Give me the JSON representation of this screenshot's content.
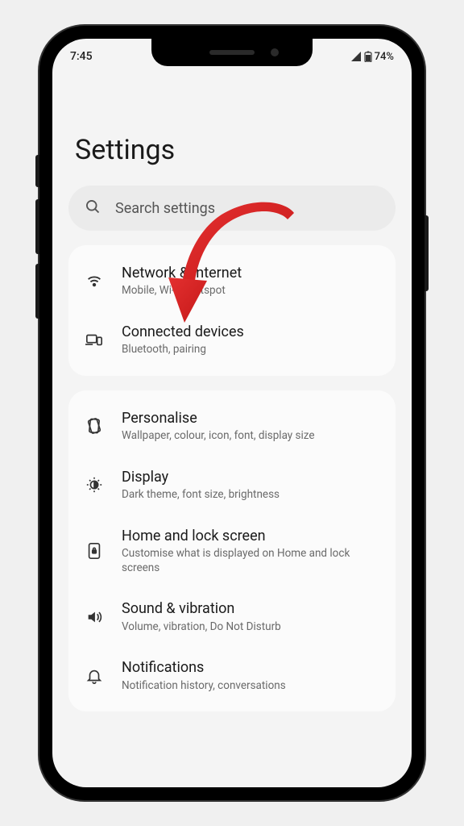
{
  "status": {
    "time": "7:45",
    "battery": "74%"
  },
  "page": {
    "title": "Settings"
  },
  "search": {
    "placeholder": "Search settings"
  },
  "groups": [
    {
      "items": [
        {
          "icon": "wifi",
          "title": "Network & Internet",
          "sub": "Mobile, Wi-Fi, hotspot"
        },
        {
          "icon": "devices",
          "title": "Connected devices",
          "sub": "Bluetooth, pairing"
        }
      ]
    },
    {
      "items": [
        {
          "icon": "palette",
          "title": "Personalise",
          "sub": "Wallpaper, colour, icon, font, display size"
        },
        {
          "icon": "brightness",
          "title": "Display",
          "sub": "Dark theme, font size, brightness"
        },
        {
          "icon": "phone-lock",
          "title": "Home and lock screen",
          "sub": "Customise what is displayed on Home and lock screens"
        },
        {
          "icon": "sound",
          "title": "Sound & vibration",
          "sub": "Volume, vibration, Do Not Disturb"
        },
        {
          "icon": "bell",
          "title": "Notifications",
          "sub": "Notification history, conversations"
        }
      ]
    }
  ],
  "annotation": {
    "arrow_color": "#d92626"
  }
}
